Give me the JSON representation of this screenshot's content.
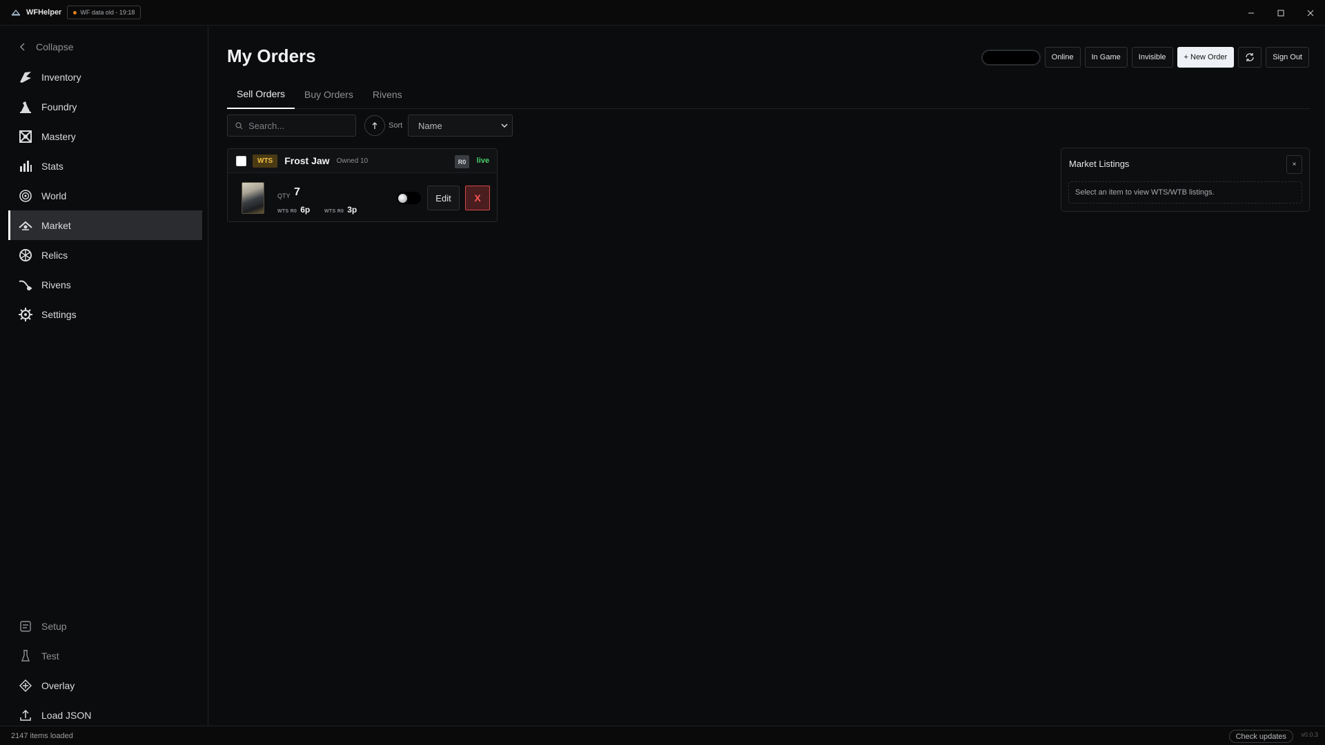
{
  "titlebar": {
    "app_name": "WFHelper",
    "data_status": "WF data old - 19:18",
    "status_color": "#e0801e",
    "controls": [
      "minimize-icon",
      "maximize-icon",
      "close-icon"
    ]
  },
  "sidebar": {
    "collapse_label": "Collapse",
    "items": [
      {
        "label": "Inventory",
        "icon": "inventory-icon"
      },
      {
        "label": "Foundry",
        "icon": "foundry-icon"
      },
      {
        "label": "Mastery",
        "icon": "mastery-icon"
      },
      {
        "label": "Stats",
        "icon": "stats-icon"
      },
      {
        "label": "World",
        "icon": "world-icon"
      },
      {
        "label": "Market",
        "icon": "market-icon",
        "active": true
      },
      {
        "label": "Relics",
        "icon": "relics-icon"
      },
      {
        "label": "Rivens",
        "icon": "rivens-icon"
      },
      {
        "label": "Settings",
        "icon": "settings-icon"
      }
    ],
    "bottom_items": [
      {
        "label": "Setup",
        "icon": "setup-icon"
      },
      {
        "label": "Test",
        "icon": "test-icon"
      },
      {
        "label": "Overlay",
        "icon": "overlay-icon"
      },
      {
        "label": "Load JSON",
        "icon": "upload-icon"
      }
    ]
  },
  "main": {
    "title": "My Orders",
    "actions": {
      "online": "Online",
      "in_game": "In Game",
      "invisible": "Invisible",
      "new_order": "+ New Order",
      "sign_out": "Sign Out"
    },
    "tabs": [
      {
        "label": "Sell Orders",
        "active": true
      },
      {
        "label": "Buy Orders"
      },
      {
        "label": "Rivens"
      }
    ],
    "search": {
      "placeholder": "Search..."
    },
    "sort": {
      "label": "Sort",
      "direction_icon": "arrow-up-icon",
      "selected": "Name"
    },
    "orders": [
      {
        "type": "WTS",
        "name": "Frost Jaw",
        "owned": "Owned 10",
        "rank_badge": "R0",
        "status": "live",
        "qty_label": "QTY",
        "qty": "7",
        "prices": [
          {
            "label": "WTS R0",
            "value": "6p"
          },
          {
            "label": "WTS R0",
            "value": "3p"
          }
        ],
        "edit_label": "Edit",
        "delete_label": "X"
      }
    ],
    "market_panel": {
      "title": "Market Listings",
      "close_label": "×",
      "message": "Select an item to view WTS/WTB listings."
    }
  },
  "statusbar": {
    "items_loaded": "2147 items loaded",
    "check_updates": "Check updates",
    "version": "v0.0.3"
  }
}
